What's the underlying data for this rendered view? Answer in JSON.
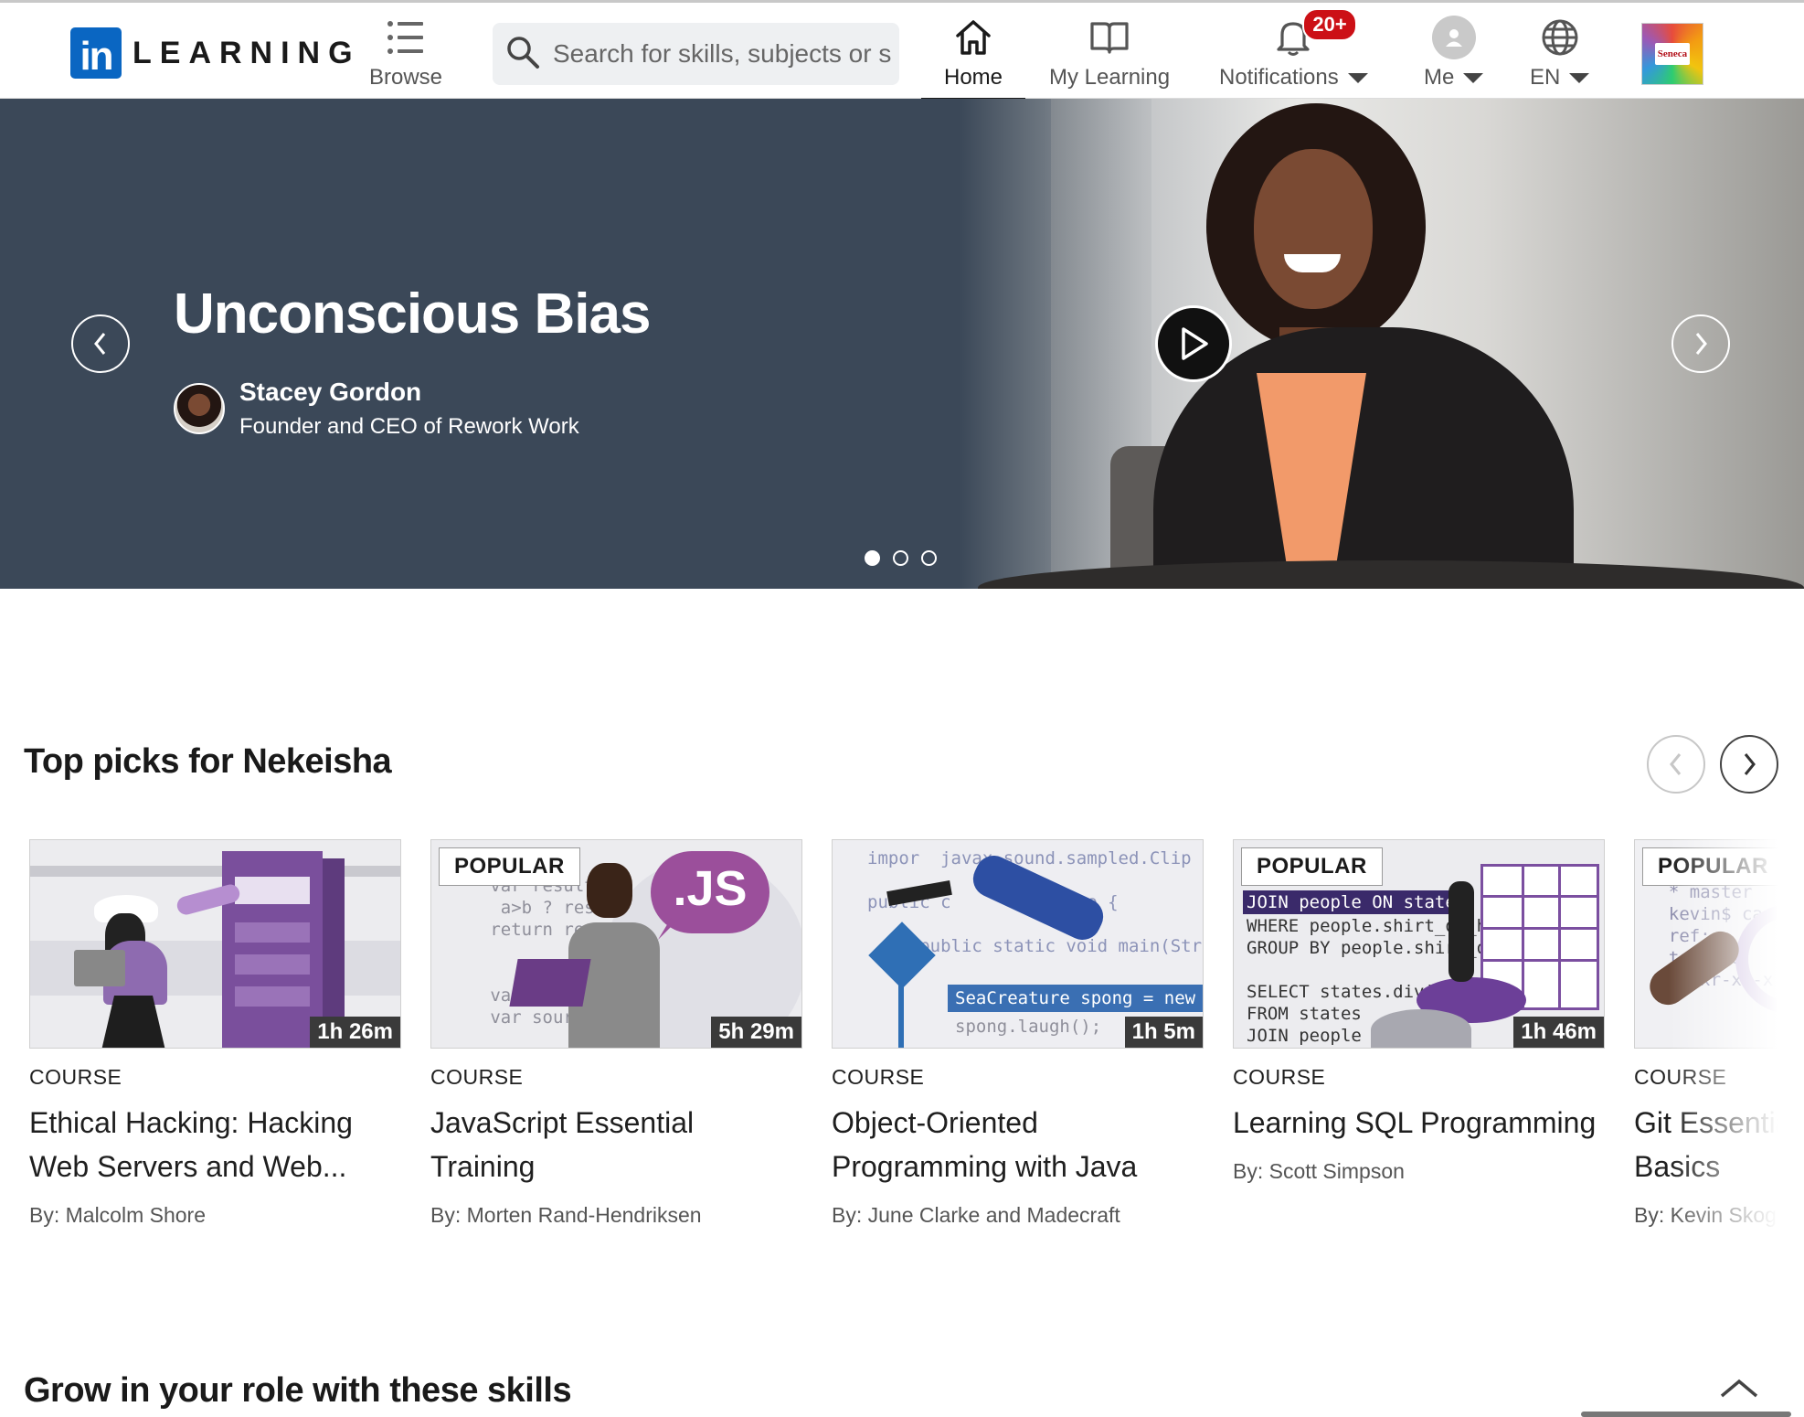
{
  "header": {
    "logo_in": "in",
    "logo_word": "LEARNING",
    "browse_label": "Browse",
    "search_placeholder": "Search for skills, subjects or software",
    "nav": {
      "home": "Home",
      "my_learning": "My Learning",
      "notifications": "Notifications",
      "notifications_badge": "20+",
      "me": "Me",
      "language": "EN"
    },
    "org_logo_text": "Seneca"
  },
  "hero": {
    "title": "Unconscious Bias",
    "author_name": "Stacey Gordon",
    "author_role": "Founder and CEO of Rework Work",
    "slides": 3,
    "active_slide": 1
  },
  "top_picks": {
    "heading": "Top picks for Nekeisha",
    "cards": [
      {
        "badge": "",
        "duration": "1h 26m",
        "kind": "COURSE",
        "title_line1": "Ethical Hacking: Hacking",
        "title_line2": "Web Servers and Web...",
        "author": "By: Malcolm Shore"
      },
      {
        "badge": "POPULAR",
        "duration": "5h 29m",
        "kind": "COURSE",
        "title_line1": "JavaScript Essential",
        "title_line2": "Training",
        "author": "By: Morten Rand-Hendriksen",
        "thumb_text": ".JS"
      },
      {
        "badge": "",
        "duration": "1h 5m",
        "kind": "COURSE",
        "title_line1": "Object-Oriented",
        "title_line2": "Programming with Java",
        "author": "By: June Clarke and Madecraft"
      },
      {
        "badge": "POPULAR",
        "duration": "1h 46m",
        "kind": "COURSE",
        "title_line1": "Learning SQL Programming",
        "title_line2": "",
        "author": "By: Scott Simpson"
      },
      {
        "badge": "POPULAR",
        "duration": "",
        "kind": "COURSE",
        "title_line1": "Git Essentials",
        "title_line2": "Basics",
        "author": "By: Kevin Skoglund"
      }
    ]
  },
  "grow": {
    "heading": "Grow in your role with these skills"
  }
}
